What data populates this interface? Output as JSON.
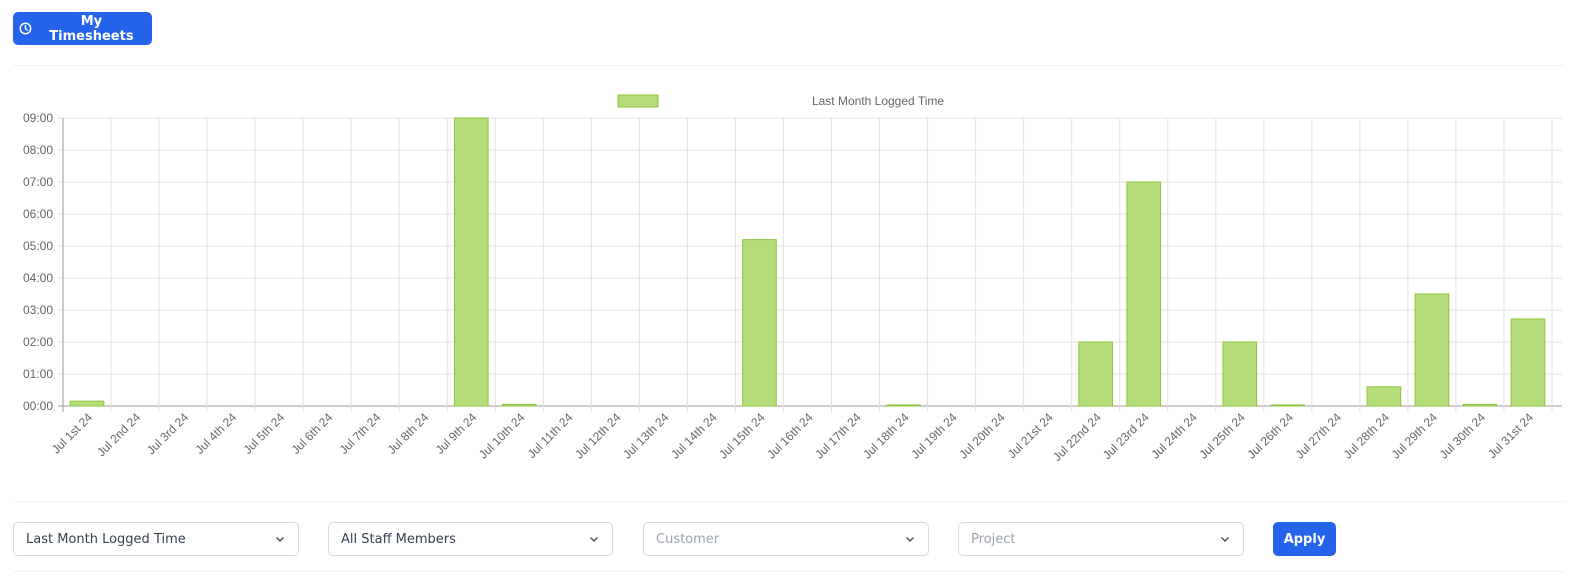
{
  "header": {
    "timesheets_button": {
      "label": "My Timesheets",
      "icon": "clock-icon",
      "color": "#2563eb"
    }
  },
  "chart_data": {
    "type": "bar",
    "title": "",
    "legend": {
      "label": "Last Month Logged Time",
      "placement": "top-center"
    },
    "xlabel": "",
    "ylabel": "",
    "ylim": [
      0,
      9
    ],
    "yticks": [
      "00:00",
      "01:00",
      "02:00",
      "03:00",
      "04:00",
      "05:00",
      "06:00",
      "07:00",
      "08:00",
      "09:00"
    ],
    "grid": true,
    "bar_fill": "#b5de7a",
    "bar_stroke": "#8cc43c",
    "categories": [
      "Jul 1st 24",
      "Jul 2nd 24",
      "Jul 3rd 24",
      "Jul 4th 24",
      "Jul 5th 24",
      "Jul 6th 24",
      "Jul 7th 24",
      "Jul 8th 24",
      "Jul 9th 24",
      "Jul 10th 24",
      "Jul 11th 24",
      "Jul 12th 24",
      "Jul 13th 24",
      "Jul 14th 24",
      "Jul 15th 24",
      "Jul 16th 24",
      "Jul 17th 24",
      "Jul 18th 24",
      "Jul 19th 24",
      "Jul 20th 24",
      "Jul 21st 24",
      "Jul 22nd 24",
      "Jul 23rd 24",
      "Jul 24th 24",
      "Jul 25th 24",
      "Jul 26th 24",
      "Jul 27th 24",
      "Jul 28th 24",
      "Jul 29th 24",
      "Jul 30th 24",
      "Jul 31st 24"
    ],
    "series": [
      {
        "name": "Last Month Logged Time",
        "unit": "hours",
        "values": [
          0.15,
          0,
          0,
          0,
          0,
          0,
          0,
          0,
          9.0,
          0.05,
          0,
          0,
          0,
          0,
          5.2,
          0,
          0,
          0.03,
          0,
          0,
          0,
          2.0,
          7.0,
          0,
          2.0,
          0.02,
          0,
          0.6,
          3.5,
          0.05,
          2.72
        ]
      }
    ]
  },
  "filters": {
    "period": {
      "value": "Last Month Logged Time"
    },
    "staff": {
      "value": "All Staff Members"
    },
    "customer": {
      "placeholder": "Customer"
    },
    "project": {
      "placeholder": "Project"
    },
    "apply_label": "Apply"
  }
}
